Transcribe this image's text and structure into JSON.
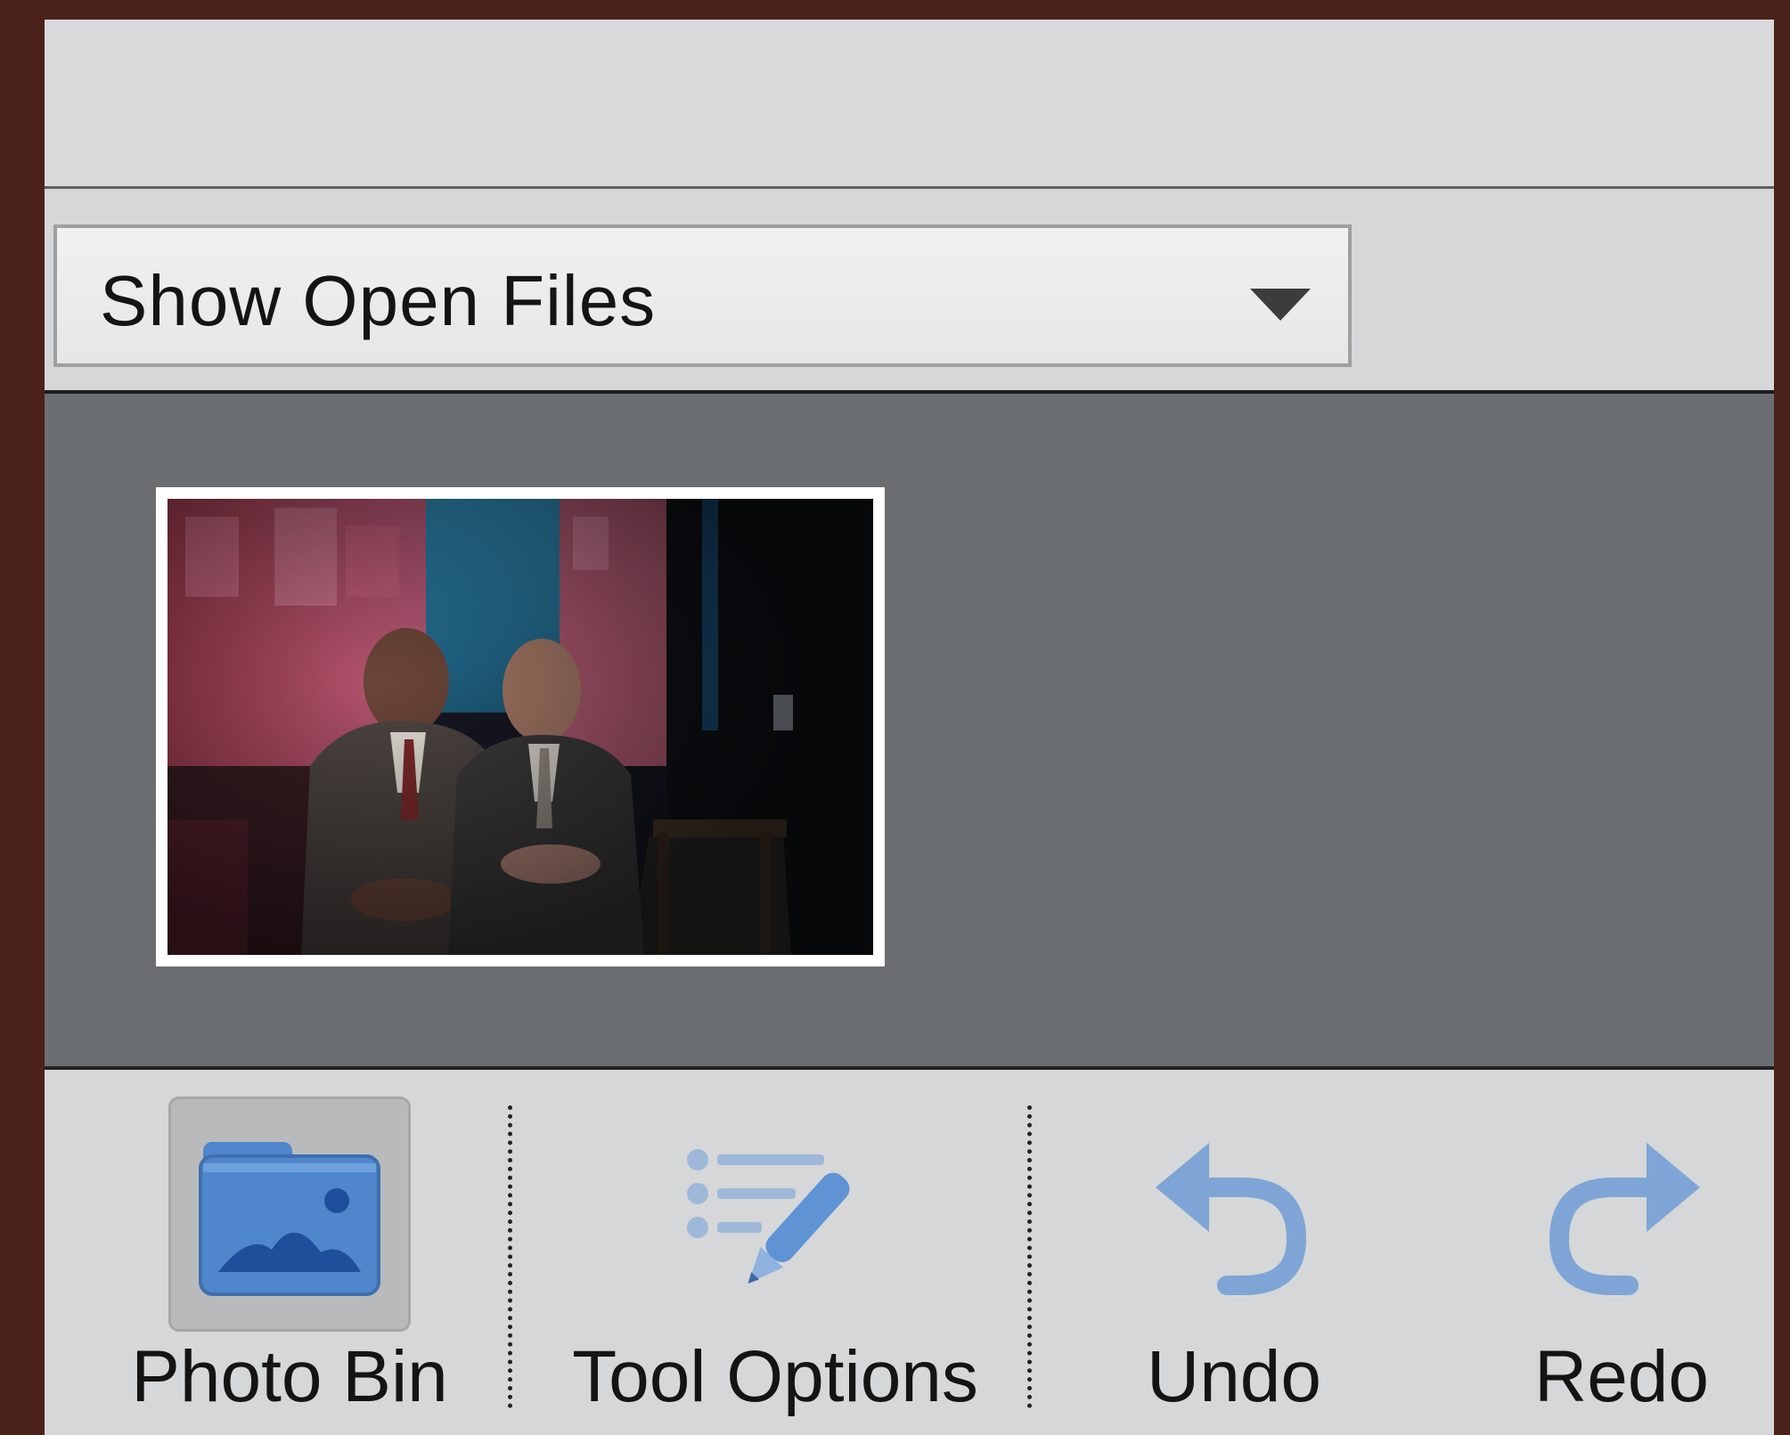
{
  "toolbar": {
    "dropdown": {
      "selected": "Show Open Files",
      "icon": "dropdown-arrow-icon"
    }
  },
  "bin": {
    "thumbnails": [
      {
        "icon": "photo-thumbnail"
      }
    ]
  },
  "taskbar": {
    "items": [
      {
        "label": "Photo Bin",
        "icon": "photo-bin-icon",
        "active": true
      },
      {
        "label": "Tool Options",
        "icon": "tool-options-icon",
        "active": false
      },
      {
        "label": "Undo",
        "icon": "undo-icon",
        "active": false
      },
      {
        "label": "Redo",
        "icon": "redo-icon",
        "active": false
      }
    ]
  },
  "colors": {
    "frame_border": "#4a211b",
    "panel_bg": "#d9dadb",
    "bin_bg": "#6b6e71",
    "icon_blue": "#5b8fd0"
  }
}
